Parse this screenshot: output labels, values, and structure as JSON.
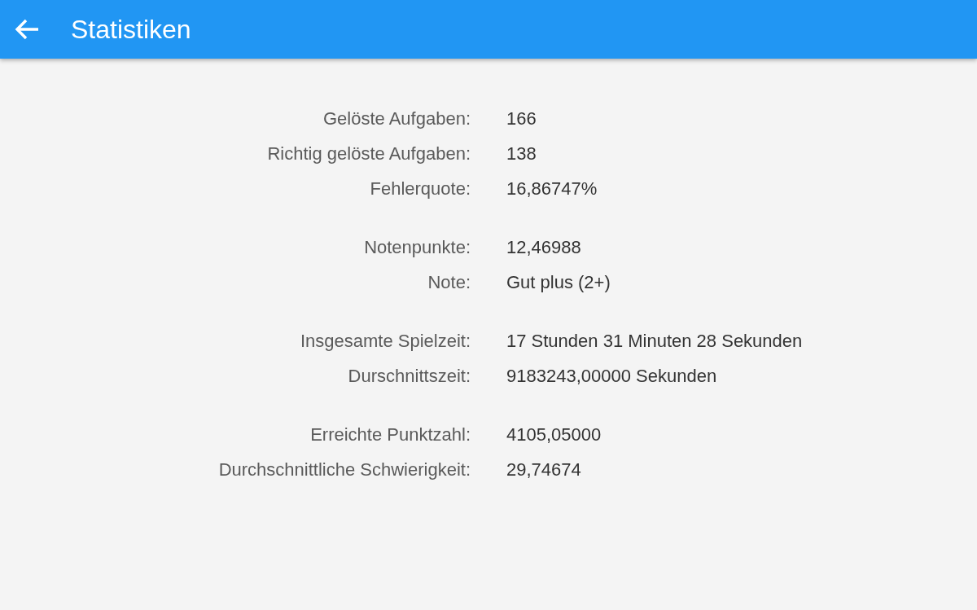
{
  "app_bar": {
    "title": "Statistiken"
  },
  "groups": [
    [
      {
        "label": "Gelöste Aufgaben:",
        "value": "166"
      },
      {
        "label": "Richtig gelöste Aufgaben:",
        "value": "138"
      },
      {
        "label": "Fehlerquote:",
        "value": "16,86747%"
      }
    ],
    [
      {
        "label": "Notenpunkte:",
        "value": "12,46988"
      },
      {
        "label": "Note:",
        "value": "Gut plus (2+)"
      }
    ],
    [
      {
        "label": "Insgesamte Spielzeit:",
        "value": "17 Stunden 31 Minuten 28 Sekunden"
      },
      {
        "label": "Durschnittszeit:",
        "value": "9183243,00000 Sekunden"
      }
    ],
    [
      {
        "label": "Erreichte Punktzahl:",
        "value": "4105,05000"
      },
      {
        "label": "Durchschnittliche Schwierigkeit:",
        "value": "29,74674"
      }
    ]
  ]
}
